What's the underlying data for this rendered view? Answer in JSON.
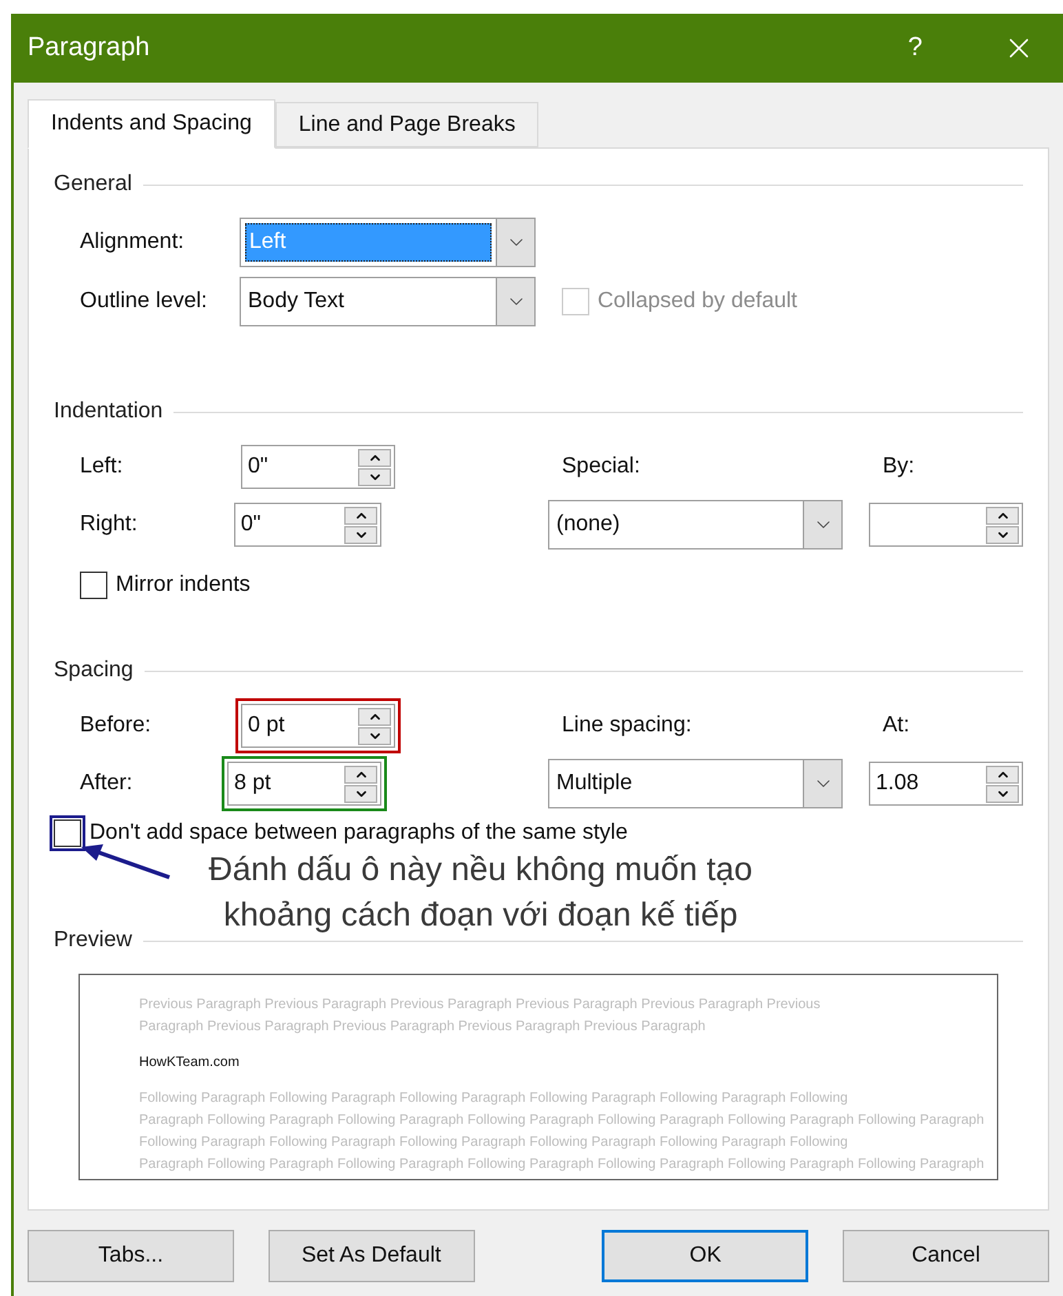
{
  "window": {
    "title": "Paragraph",
    "help": "?"
  },
  "tabs": [
    {
      "label": "Indents and Spacing",
      "selected": true
    },
    {
      "label": "Line and Page Breaks",
      "selected": false
    }
  ],
  "general": {
    "heading": "General",
    "alignment": {
      "label": "Alignment:",
      "value": "Left",
      "highlighted": true
    },
    "outline_level": {
      "label": "Outline level:",
      "value": "Body Text",
      "highlighted": false
    },
    "collapsed": {
      "label": "Collapsed by default",
      "checked": false,
      "disabled": true
    }
  },
  "indentation": {
    "heading": "Indentation",
    "left": {
      "label": "Left:",
      "value": "0\""
    },
    "right": {
      "label": "Right:",
      "value": "0\""
    },
    "special": {
      "label": "Special:",
      "value": "(none)"
    },
    "by": {
      "label": "By:"
    },
    "mirror": {
      "label": "Mirror indents",
      "checked": false
    }
  },
  "spacing": {
    "heading": "Spacing",
    "before": {
      "label": "Before:",
      "value": "0 pt",
      "color": "#c00000"
    },
    "after": {
      "label": "After:",
      "value": "8 pt",
      "color": "#1a8a1a"
    },
    "line_spacing": {
      "label": "Line spacing:",
      "value": "Multiple"
    },
    "at": {
      "label": "At:",
      "value": "1.08"
    },
    "dont_add": {
      "label": "Don't add space between paragraphs of the same style",
      "checked": false,
      "color": "#1c1c8c"
    }
  },
  "annotation": {
    "lines": [
      "Đánh dấu ô này nều không muốn tạo",
      "khoảng cách đoạn với đoạn kế tiếp"
    ]
  },
  "preview": {
    "heading": "Preview",
    "previous_lines": [
      "Previous Paragraph Previous Paragraph Previous Paragraph Previous Paragraph Previous Paragraph Previous",
      "Paragraph Previous Paragraph Previous Paragraph Previous Paragraph Previous Paragraph"
    ],
    "sample": "HowKTeam.com",
    "following_lines": [
      "Following Paragraph Following Paragraph Following Paragraph Following Paragraph Following Paragraph Following",
      "Paragraph Following Paragraph Following Paragraph Following Paragraph Following Paragraph Following Paragraph Following Paragraph",
      "Following Paragraph Following Paragraph Following Paragraph Following Paragraph Following Paragraph Following",
      "Paragraph Following Paragraph Following Paragraph Following Paragraph Following Paragraph Following Paragraph Following Paragraph"
    ]
  },
  "buttons": [
    {
      "label": "Tabs...",
      "default": false
    },
    {
      "label": "Set As Default",
      "default": false
    },
    {
      "label": "OK",
      "default": true
    },
    {
      "label": "Cancel",
      "default": false
    }
  ]
}
